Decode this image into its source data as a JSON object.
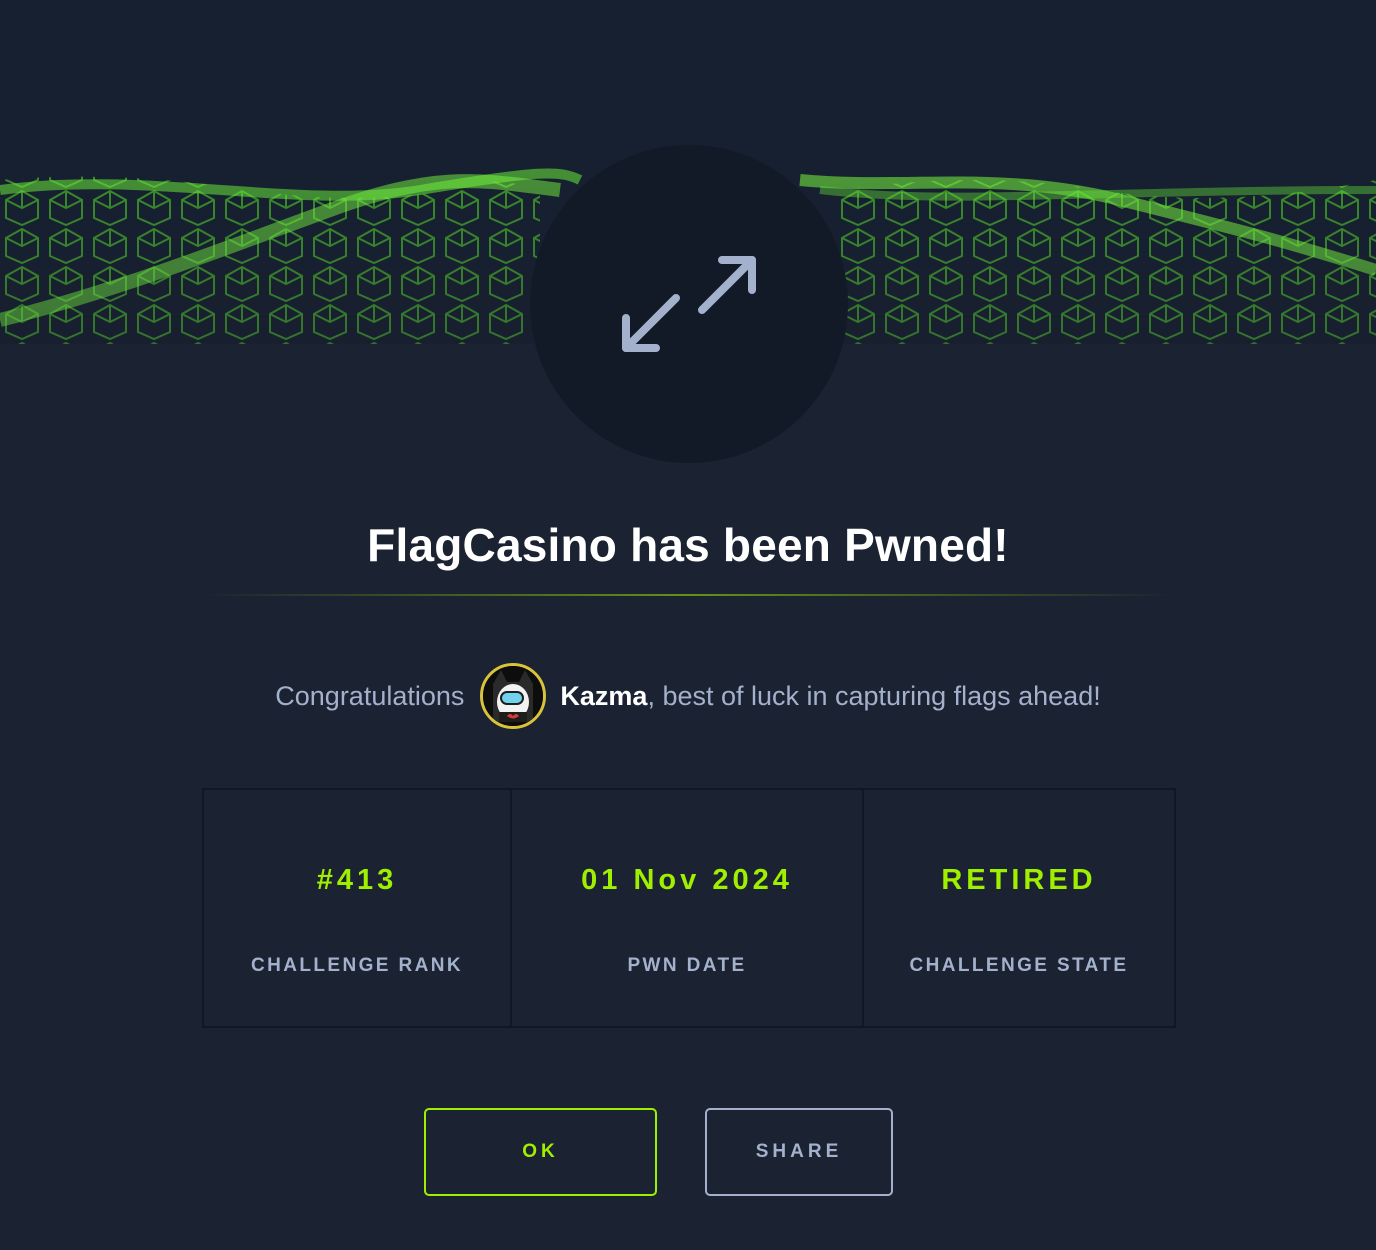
{
  "modal": {
    "title": "FlagCasino has been Pwned!",
    "congrats_prefix": "Congratulations",
    "username": "Kazma",
    "congrats_suffix": ", best of luck in capturing flags ahead!",
    "banner_icon": "swap-arrows-icon",
    "avatar_icon": "user-avatar"
  },
  "stats": [
    {
      "value": "#413",
      "label": "CHALLENGE RANK"
    },
    {
      "value": "01 Nov 2024",
      "label": "PWN DATE"
    },
    {
      "value": "RETIRED",
      "label": "CHALLENGE STATE"
    }
  ],
  "buttons": {
    "ok": "OK",
    "share": "SHARE"
  },
  "colors": {
    "background": "#1b2231",
    "accent": "#9fef00",
    "text_muted": "#a4b1cd",
    "text_primary": "#ffffff"
  }
}
